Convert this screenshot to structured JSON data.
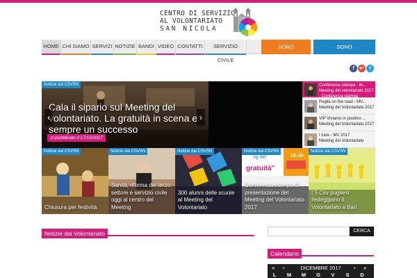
{
  "header": {
    "logo_lines": [
      "CENTRO DI SERVIZIO",
      "AL VOLONTARIATO",
      "SAN NICOLA"
    ]
  },
  "nav": {
    "items": [
      "HOME",
      "CHI SIAMO",
      "SERVIZI",
      "NOTIZIE",
      "BANDI",
      "VIDEO",
      "CONTATTI",
      "SERVIZIO CIVILE"
    ],
    "cta1": "SONO VOLONTARIO",
    "cta2": "SONO UN'ASSOCIAZIONE",
    "active_color": "#d81b7a",
    "cta1_color": "#f07c1e",
    "cta2_color": "#1e88c7"
  },
  "social": {
    "icons": [
      "facebook-icon",
      "google-plus-icon",
      "twitter-icon"
    ],
    "letters": [
      "f",
      "g+",
      "t"
    ]
  },
  "hero": {
    "tag": "Notizie dal CSVSN",
    "title": "Cala il sipario sul Meeting del volontariato. La gratuità in scena e sempre un successo",
    "published": "⊙ pubblicato il 17/12/2017",
    "prev": "‹",
    "next": "›"
  },
  "sidebar_list": [
    {
      "title": "Conferenza stampa - M...",
      "sub": "Meeting del volontariato 2017 - Conferenza stampa"
    },
    {
      "title": "Puglia on the road - MV...",
      "sub": "Meeting del Volontariato 2017"
    },
    {
      "title": "VIP Viviamo in positivo ...",
      "sub": "Meeting del Volontariato 2017"
    },
    {
      "title": "I care - MV 2017",
      "sub": "Meeting del Volontariato"
    }
  ],
  "tiles": [
    {
      "tag": "Notizie dal CSVSN",
      "title": "Chiusura per festività"
    },
    {
      "tag": "Notizie dal CSVSN",
      "title": "Sanità, riforma del terzo settore e servizio civile oggi al centro del Meeting"
    },
    {
      "tag": "Notizie dal CSVSN",
      "title": "300 alunni delle scuole al Meeting del Volontariato"
    },
    {
      "tag": "Notizie dal CSVSN",
      "title": "Conferenza stampa di presentazione del Meeting del Volontariato 2017",
      "img_text_1": "ng del",
      "img_text_2": "gratuità\"",
      "img_text_3": "15-16-"
    },
    {
      "tag": "Notizie dal CSVSN",
      "title": "I 5 Csv pugliesi festeggiano il Volontariato a Bari"
    }
  ],
  "section": {
    "title": "Notizie dal Volontariato"
  },
  "search": {
    "placeholder": "",
    "button": "CERCA"
  },
  "calendar": {
    "title": "Calendario",
    "prev": "«",
    "prev_one": "‹",
    "month": "DICEMBRE 2017",
    "next_one": "›",
    "next": "»",
    "days": [
      "L",
      "M",
      "M",
      "G",
      "V",
      "S",
      "D"
    ]
  },
  "colors": {
    "accent": "#d81b7a",
    "tag_blue": "#1e88c7",
    "dark": "#1f1f1f"
  }
}
